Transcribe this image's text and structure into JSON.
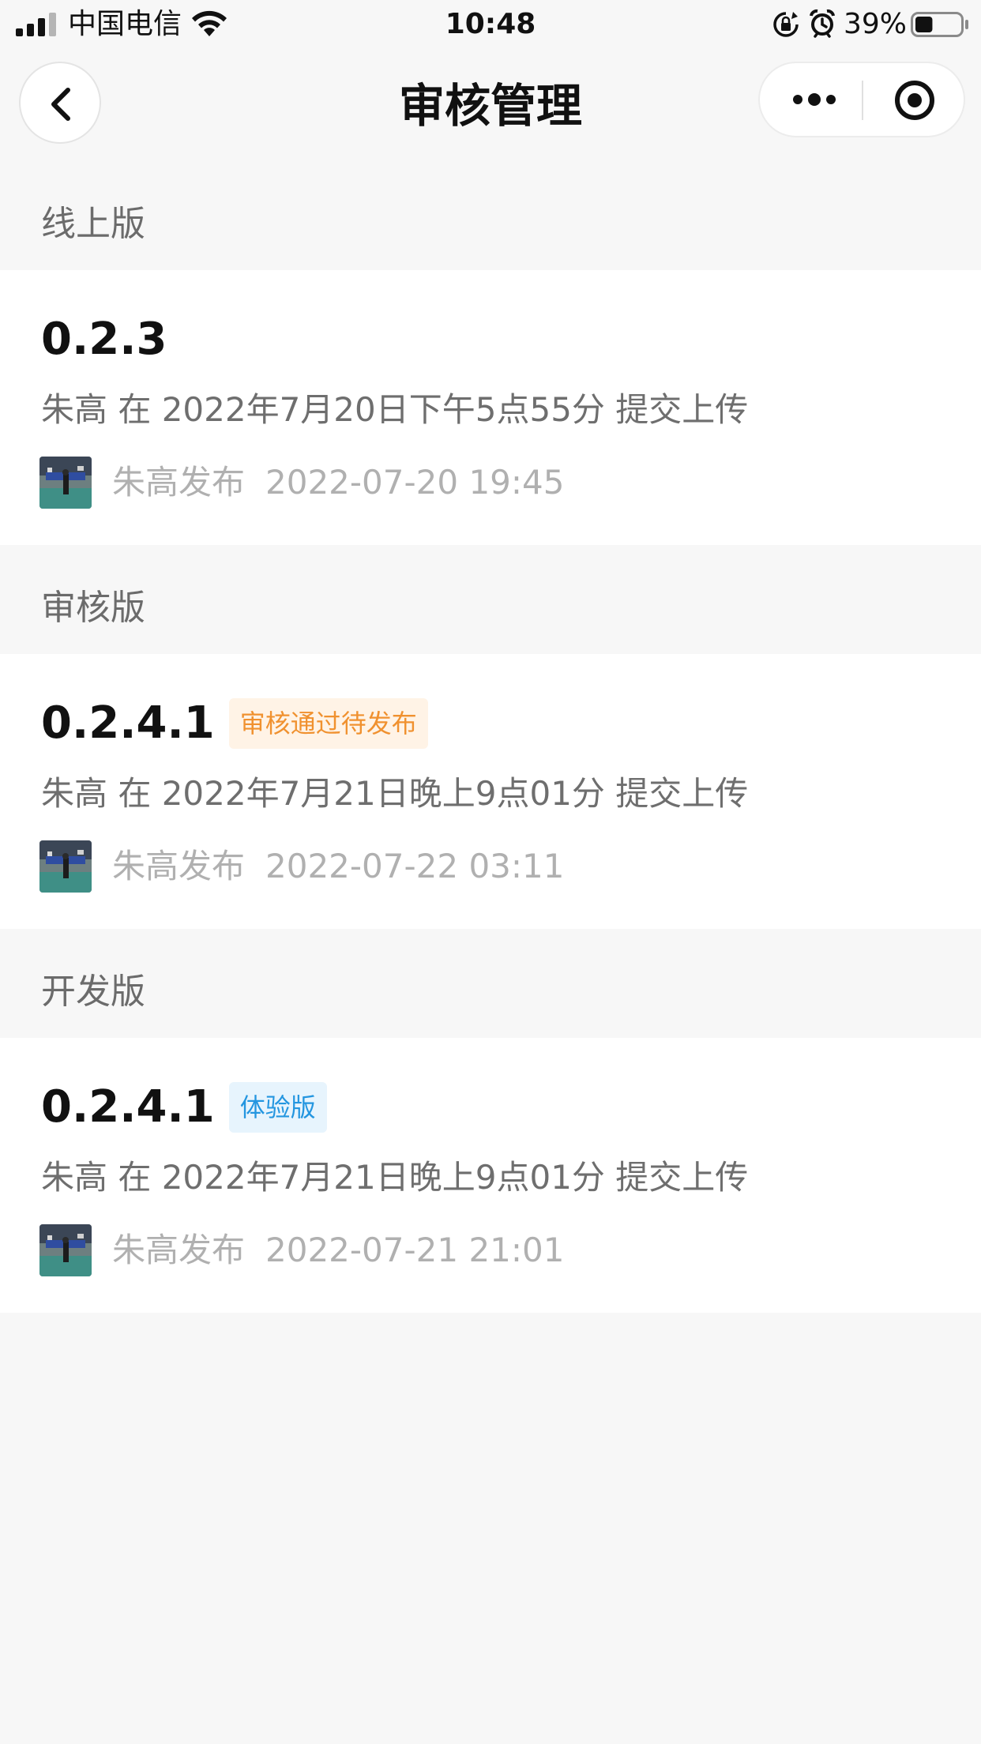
{
  "status_bar": {
    "carrier": "中国电信",
    "time": "10:48",
    "battery_percent": "39%",
    "battery_level": 0.39,
    "icons": [
      "signal-icon",
      "wifi-icon",
      "rotation-lock-icon",
      "alarm-icon",
      "battery-icon"
    ]
  },
  "nav": {
    "title": "审核管理",
    "icons": [
      "back-chevron-icon",
      "more-dots-icon",
      "target-circle-icon"
    ]
  },
  "sections": [
    {
      "header": "线上版",
      "version": "0.2.3",
      "tag": "",
      "submit_text": "朱高 在 2022年7月20日下午5点55分 提交上传",
      "publisher": "朱高发布",
      "publish_time": "2022-07-20 19:45"
    },
    {
      "header": "审核版",
      "version": "0.2.4.1",
      "tag": "审核通过待发布",
      "submit_text": "朱高 在 2022年7月21日晚上9点01分 提交上传",
      "publisher": "朱高发布",
      "publish_time": "2022-07-22 03:11"
    },
    {
      "header": "开发版",
      "version": "0.2.4.1",
      "tag": "体验版",
      "submit_text": "朱高 在 2022年7月21日晚上9点01分 提交上传",
      "publisher": "朱高发布",
      "publish_time": "2022-07-21 21:01"
    }
  ],
  "colors": {
    "background": "#f7f7f7",
    "card": "#ffffff",
    "tag_orange_text": "#f0912f",
    "tag_orange_bg": "#fff3e6",
    "tag_blue_text": "#2496e0",
    "tag_blue_bg": "#e7f4fd"
  }
}
